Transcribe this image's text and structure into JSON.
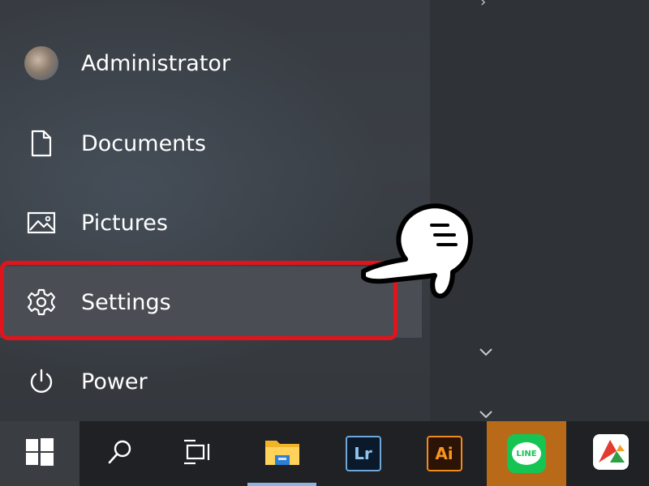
{
  "start_menu": {
    "items": [
      {
        "label": "Administrator",
        "icon": "avatar"
      },
      {
        "label": "Documents",
        "icon": "document-icon"
      },
      {
        "label": "Pictures",
        "icon": "pictures-icon"
      },
      {
        "label": "Settings",
        "icon": "gear-icon",
        "highlighted": true
      },
      {
        "label": "Power",
        "icon": "power-icon"
      }
    ]
  },
  "annotation": {
    "highlight_color": "#e0141c",
    "pointer": "pointing-hand-icon"
  },
  "taskbar": {
    "items": [
      {
        "name": "start",
        "icon": "windows-logo-icon"
      },
      {
        "name": "search",
        "icon": "search-icon"
      },
      {
        "name": "task-view",
        "icon": "task-view-icon"
      },
      {
        "name": "file-explorer",
        "icon": "folder-icon",
        "active": true
      },
      {
        "name": "lightroom",
        "label": "Lr"
      },
      {
        "name": "illustrator",
        "label": "Ai"
      },
      {
        "name": "line",
        "label": "LINE",
        "active": true
      },
      {
        "name": "app",
        "icon": "app-icon"
      }
    ]
  },
  "colors": {
    "accent_line": "#b86a18",
    "taskbar": "#1f2124"
  }
}
